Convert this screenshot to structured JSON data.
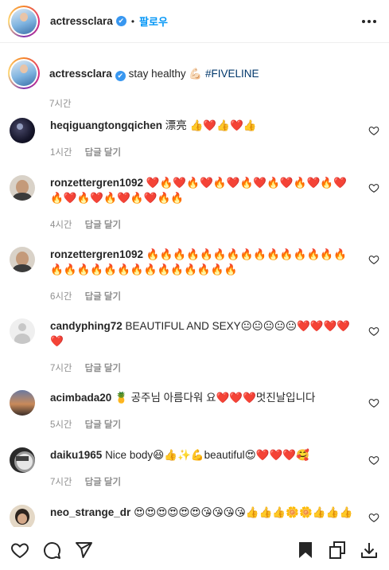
{
  "header": {
    "username": "actressclara",
    "verified": "✔",
    "separator": "•",
    "follow_label": "팔로우"
  },
  "caption": {
    "username": "actressclara",
    "verified": "✔",
    "text": "stay healthy 💪🏻 ",
    "hashtag": "#FIVELINE",
    "time": "7시간"
  },
  "comments": [
    {
      "username": "heqiguangtongqichen",
      "text": "漂亮 👍❤️👍❤️👍",
      "time": "1시간",
      "reply": "답글 달기"
    },
    {
      "username": "ronzettergren1092",
      "text": "❤️🔥❤️🔥❤️🔥❤️🔥❤️🔥❤️🔥❤️🔥❤️🔥❤️🔥❤️🔥❤️🔥❤️🔥🔥",
      "time": "4시간",
      "reply": "답글 달기"
    },
    {
      "username": "ronzettergren1092",
      "text": "🔥🔥🔥🔥🔥🔥🔥🔥🔥🔥🔥🔥🔥🔥🔥🔥🔥🔥🔥🔥🔥🔥🔥🔥🔥🔥🔥🔥🔥",
      "time": "6시간",
      "reply": "답글 달기"
    },
    {
      "username": "candyphing72",
      "text": "BEAUTIFUL AND SEXY😐😐😐😐😐❤️❤️❤️❤️❤️",
      "time": "7시간",
      "reply": "답글 달기"
    },
    {
      "username": "acimbada20",
      "text": "🍍 공주님 아름다워 요❤️❤️❤️멋진날입니다",
      "time": "5시간",
      "reply": "답글 달기"
    },
    {
      "username": "daiku1965",
      "text": "Nice body😆👍✨💪beautiful😍❤️❤️❤️🥰",
      "time": "7시간",
      "reply": "답글 달기"
    },
    {
      "username": "neo_strange_dr",
      "text": "😍😍😍😍😍😍😘😘😘😘👍👍👍🌼🌼👍👍👍",
      "time": "",
      "reply": ""
    }
  ],
  "icons": {
    "heart": "heart-icon",
    "comment": "comment-icon",
    "share": "share-icon",
    "bookmark": "bookmark-icon",
    "copy": "copy-icon",
    "download": "download-icon"
  },
  "colors": {
    "link": "#0095f6",
    "hashtag": "#00376b",
    "verified": "#3897f0",
    "meta": "#8e8e8e"
  }
}
